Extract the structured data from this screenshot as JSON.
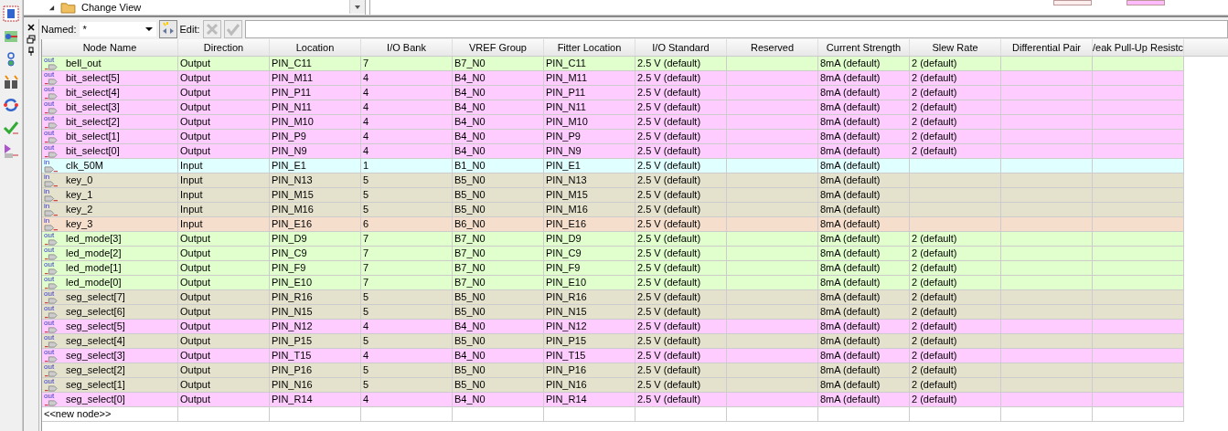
{
  "top_panel": {
    "tree_item": "Change View"
  },
  "filter": {
    "label": "Named:",
    "value": "*",
    "edit_label": "Edit:"
  },
  "columns": [
    "Node Name",
    "Direction",
    "Location",
    "I/O Bank",
    "VREF Group",
    "Fitter Location",
    "I/O Standard",
    "Reserved",
    "Current Strength",
    "Slew Rate",
    "Differential Pair",
    "/eak Pull-Up Resistc"
  ],
  "rows": [
    {
      "kind": "output",
      "tag": "out",
      "color": "#e0ffcc",
      "cells": [
        "bell_out",
        "Output",
        "PIN_C11",
        "7",
        "B7_N0",
        "PIN_C11",
        "2.5 V (default)",
        "",
        "8mA (default)",
        "2 (default)",
        "",
        ""
      ]
    },
    {
      "kind": "output",
      "tag": "out",
      "color": "#ffccff",
      "cells": [
        "bit_select[5]",
        "Output",
        "PIN_M11",
        "4",
        "B4_N0",
        "PIN_M11",
        "2.5 V (default)",
        "",
        "8mA (default)",
        "2 (default)",
        "",
        ""
      ]
    },
    {
      "kind": "output",
      "tag": "out",
      "color": "#ffccff",
      "cells": [
        "bit_select[4]",
        "Output",
        "PIN_P11",
        "4",
        "B4_N0",
        "PIN_P11",
        "2.5 V (default)",
        "",
        "8mA (default)",
        "2 (default)",
        "",
        ""
      ]
    },
    {
      "kind": "output",
      "tag": "out",
      "color": "#ffccff",
      "cells": [
        "bit_select[3]",
        "Output",
        "PIN_N11",
        "4",
        "B4_N0",
        "PIN_N11",
        "2.5 V (default)",
        "",
        "8mA (default)",
        "2 (default)",
        "",
        ""
      ]
    },
    {
      "kind": "output",
      "tag": "out",
      "color": "#ffccff",
      "cells": [
        "bit_select[2]",
        "Output",
        "PIN_M10",
        "4",
        "B4_N0",
        "PIN_M10",
        "2.5 V (default)",
        "",
        "8mA (default)",
        "2 (default)",
        "",
        ""
      ]
    },
    {
      "kind": "output",
      "tag": "out",
      "color": "#ffccff",
      "cells": [
        "bit_select[1]",
        "Output",
        "PIN_P9",
        "4",
        "B4_N0",
        "PIN_P9",
        "2.5 V (default)",
        "",
        "8mA (default)",
        "2 (default)",
        "",
        ""
      ]
    },
    {
      "kind": "output",
      "tag": "out",
      "color": "#ffccff",
      "cells": [
        "bit_select[0]",
        "Output",
        "PIN_N9",
        "4",
        "B4_N0",
        "PIN_N9",
        "2.5 V (default)",
        "",
        "8mA (default)",
        "2 (default)",
        "",
        ""
      ]
    },
    {
      "kind": "input",
      "tag": "in",
      "color": "#e0ffff",
      "cells": [
        "clk_50M",
        "Input",
        "PIN_E1",
        "1",
        "B1_N0",
        "PIN_E1",
        "2.5 V (default)",
        "",
        "8mA (default)",
        "",
        "",
        ""
      ]
    },
    {
      "kind": "input",
      "tag": "in",
      "color": "#e4e2cc",
      "cells": [
        "key_0",
        "Input",
        "PIN_N13",
        "5",
        "B5_N0",
        "PIN_N13",
        "2.5 V (default)",
        "",
        "8mA (default)",
        "",
        "",
        ""
      ]
    },
    {
      "kind": "input",
      "tag": "in",
      "color": "#e4e2cc",
      "cells": [
        "key_1",
        "Input",
        "PIN_M15",
        "5",
        "B5_N0",
        "PIN_M15",
        "2.5 V (default)",
        "",
        "8mA (default)",
        "",
        "",
        ""
      ]
    },
    {
      "kind": "input",
      "tag": "in",
      "color": "#e4e2cc",
      "cells": [
        "key_2",
        "Input",
        "PIN_M16",
        "5",
        "B5_N0",
        "PIN_M16",
        "2.5 V (default)",
        "",
        "8mA (default)",
        "",
        "",
        ""
      ]
    },
    {
      "kind": "input",
      "tag": "in",
      "color": "#f5dfcc",
      "cells": [
        "key_3",
        "Input",
        "PIN_E16",
        "6",
        "B6_N0",
        "PIN_E16",
        "2.5 V (default)",
        "",
        "8mA (default)",
        "",
        "",
        ""
      ]
    },
    {
      "kind": "output",
      "tag": "out",
      "color": "#e0ffcc",
      "cells": [
        "led_mode[3]",
        "Output",
        "PIN_D9",
        "7",
        "B7_N0",
        "PIN_D9",
        "2.5 V (default)",
        "",
        "8mA (default)",
        "2 (default)",
        "",
        ""
      ]
    },
    {
      "kind": "output",
      "tag": "out",
      "color": "#e0ffcc",
      "cells": [
        "led_mode[2]",
        "Output",
        "PIN_C9",
        "7",
        "B7_N0",
        "PIN_C9",
        "2.5 V (default)",
        "",
        "8mA (default)",
        "2 (default)",
        "",
        ""
      ]
    },
    {
      "kind": "output",
      "tag": "out",
      "color": "#e0ffcc",
      "cells": [
        "led_mode[1]",
        "Output",
        "PIN_F9",
        "7",
        "B7_N0",
        "PIN_F9",
        "2.5 V (default)",
        "",
        "8mA (default)",
        "2 (default)",
        "",
        ""
      ]
    },
    {
      "kind": "output",
      "tag": "out",
      "color": "#e0ffcc",
      "cells": [
        "led_mode[0]",
        "Output",
        "PIN_E10",
        "7",
        "B7_N0",
        "PIN_E10",
        "2.5 V (default)",
        "",
        "8mA (default)",
        "2 (default)",
        "",
        ""
      ]
    },
    {
      "kind": "output",
      "tag": "out",
      "color": "#e4e2cc",
      "cells": [
        "seg_select[7]",
        "Output",
        "PIN_R16",
        "5",
        "B5_N0",
        "PIN_R16",
        "2.5 V (default)",
        "",
        "8mA (default)",
        "2 (default)",
        "",
        ""
      ]
    },
    {
      "kind": "output",
      "tag": "out",
      "color": "#e4e2cc",
      "cells": [
        "seg_select[6]",
        "Output",
        "PIN_N15",
        "5",
        "B5_N0",
        "PIN_N15",
        "2.5 V (default)",
        "",
        "8mA (default)",
        "2 (default)",
        "",
        ""
      ]
    },
    {
      "kind": "output",
      "tag": "out",
      "color": "#ffccff",
      "cells": [
        "seg_select[5]",
        "Output",
        "PIN_N12",
        "4",
        "B4_N0",
        "PIN_N12",
        "2.5 V (default)",
        "",
        "8mA (default)",
        "2 (default)",
        "",
        ""
      ]
    },
    {
      "kind": "output",
      "tag": "out",
      "color": "#e4e2cc",
      "cells": [
        "seg_select[4]",
        "Output",
        "PIN_P15",
        "5",
        "B5_N0",
        "PIN_P15",
        "2.5 V (default)",
        "",
        "8mA (default)",
        "2 (default)",
        "",
        ""
      ]
    },
    {
      "kind": "output",
      "tag": "out",
      "color": "#ffccff",
      "cells": [
        "seg_select[3]",
        "Output",
        "PIN_T15",
        "4",
        "B4_N0",
        "PIN_T15",
        "2.5 V (default)",
        "",
        "8mA (default)",
        "2 (default)",
        "",
        ""
      ]
    },
    {
      "kind": "output",
      "tag": "out",
      "color": "#e4e2cc",
      "cells": [
        "seg_select[2]",
        "Output",
        "PIN_P16",
        "5",
        "B5_N0",
        "PIN_P16",
        "2.5 V (default)",
        "",
        "8mA (default)",
        "2 (default)",
        "",
        ""
      ]
    },
    {
      "kind": "output",
      "tag": "out",
      "color": "#e4e2cc",
      "cells": [
        "seg_select[1]",
        "Output",
        "PIN_N16",
        "5",
        "B5_N0",
        "PIN_N16",
        "2.5 V (default)",
        "",
        "8mA (default)",
        "2 (default)",
        "",
        ""
      ]
    },
    {
      "kind": "output",
      "tag": "out",
      "color": "#ffccff",
      "cells": [
        "seg_select[0]",
        "Output",
        "PIN_R14",
        "4",
        "B4_N0",
        "PIN_R14",
        "2.5 V (default)",
        "",
        "8mA (default)",
        "2 (default)",
        "",
        ""
      ]
    }
  ],
  "new_row": "<<new node>>"
}
